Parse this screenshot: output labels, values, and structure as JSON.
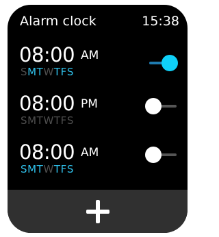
{
  "header": {
    "title": "Alarm clock",
    "time": "15:38"
  },
  "colors": {
    "active_day": "#2fc0ea",
    "inactive_day": "#4e4e4e",
    "toggle_on": "#0fd0f8",
    "footer_bg": "#303030"
  },
  "alarms": [
    {
      "time": "08:00",
      "period": "AM",
      "enabled": true,
      "days": [
        {
          "letter": "S",
          "active": false
        },
        {
          "letter": "M",
          "active": true
        },
        {
          "letter": "T",
          "active": true
        },
        {
          "letter": "W",
          "active": false
        },
        {
          "letter": "T",
          "active": true
        },
        {
          "letter": "F",
          "active": true
        },
        {
          "letter": "S",
          "active": true
        }
      ]
    },
    {
      "time": "08:00",
      "period": "PM",
      "enabled": false,
      "days": [
        {
          "letter": "S",
          "active": false
        },
        {
          "letter": "M",
          "active": false
        },
        {
          "letter": "T",
          "active": false
        },
        {
          "letter": "W",
          "active": false
        },
        {
          "letter": "T",
          "active": false
        },
        {
          "letter": "F",
          "active": false
        },
        {
          "letter": "S",
          "active": false
        }
      ]
    },
    {
      "time": "08:00",
      "period": "AM",
      "enabled": false,
      "days": [
        {
          "letter": "S",
          "active": true
        },
        {
          "letter": "M",
          "active": true
        },
        {
          "letter": "T",
          "active": true
        },
        {
          "letter": "W",
          "active": false
        },
        {
          "letter": "T",
          "active": true
        },
        {
          "letter": "F",
          "active": true
        },
        {
          "letter": "S",
          "active": true
        }
      ]
    }
  ],
  "footer": {
    "add_icon": "plus-icon"
  }
}
